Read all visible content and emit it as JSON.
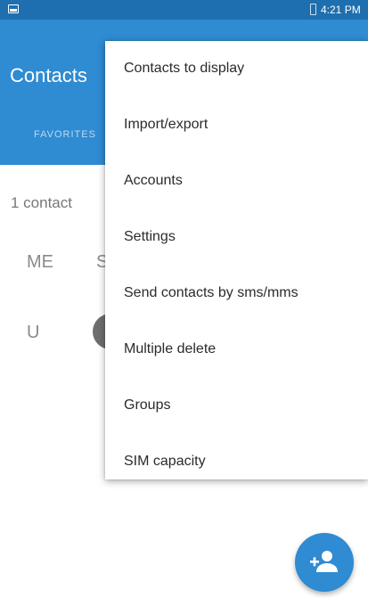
{
  "status_bar": {
    "time": "4:21 PM",
    "left_icon": "screenshot-icon",
    "battery_icon": "battery-icon"
  },
  "toolbar": {
    "title": "Contacts",
    "tab_favorites": "FAVORITES"
  },
  "list": {
    "count_text": "1 contact",
    "me_header": "ME",
    "me_name": "S",
    "u_header": "U"
  },
  "menu": {
    "items": [
      {
        "label": "Contacts to display"
      },
      {
        "label": "Import/export"
      },
      {
        "label": "Accounts"
      },
      {
        "label": "Settings"
      },
      {
        "label": "Send contacts by sms/mms"
      },
      {
        "label": "Multiple delete"
      },
      {
        "label": "Groups"
      },
      {
        "label": "SIM capacity"
      }
    ]
  },
  "fab": {
    "icon": "add-contact-icon"
  },
  "colors": {
    "status_bar": "#1e6fb0",
    "toolbar": "#2f8bd2",
    "fab": "#2f8bd2"
  }
}
